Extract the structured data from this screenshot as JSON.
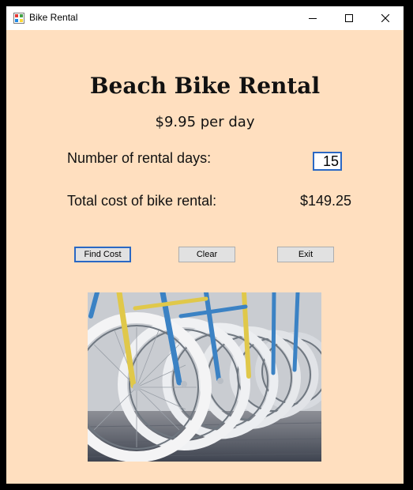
{
  "window": {
    "title": "Bike Rental",
    "icon": "form-app-icon",
    "controls": [
      "minimize-icon",
      "maximize-icon",
      "close-icon"
    ]
  },
  "form": {
    "heading": "Beach Bike Rental",
    "price_text": "$9.95 per day",
    "days_label": "Number of rental days:",
    "days_value": "15",
    "total_label": "Total cost of bike rental:",
    "total_value": "$149.25"
  },
  "buttons": {
    "find_cost": "Find Cost",
    "clear": "Clear",
    "exit": "Exit"
  },
  "image": {
    "subject": "row-of-bicycles-photo"
  },
  "colors": {
    "background": "#ffdfbf",
    "accent": "#2a68c4"
  }
}
